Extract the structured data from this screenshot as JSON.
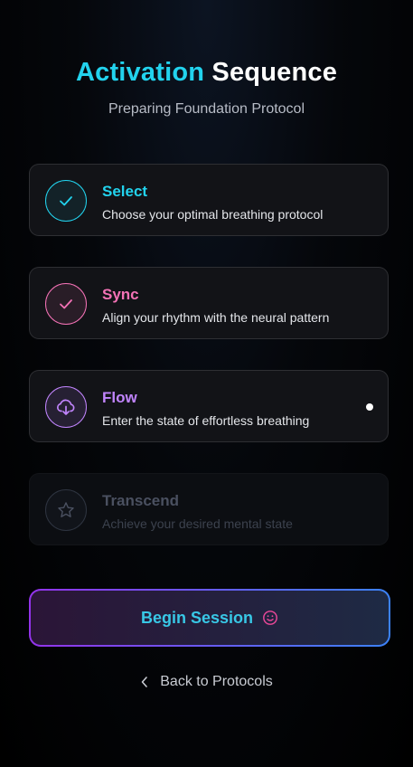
{
  "header": {
    "title_accent": "Activation",
    "title_main": "Sequence",
    "subtitle": "Preparing Foundation Protocol"
  },
  "steps": [
    {
      "name": "Select",
      "description": "Choose your optimal breathing protocol",
      "status": "completed",
      "icon": "check-icon",
      "color": "#22d3ee"
    },
    {
      "name": "Sync",
      "description": "Align your rhythm with the neural pattern",
      "status": "completed",
      "icon": "check-icon",
      "color": "#f472b6"
    },
    {
      "name": "Flow",
      "description": "Enter the state of effortless breathing",
      "status": "active",
      "icon": "cloud-download-icon",
      "color": "#c084fc"
    },
    {
      "name": "Transcend",
      "description": "Achieve your desired mental state",
      "status": "locked",
      "icon": "star-icon",
      "color": "#4a5060"
    }
  ],
  "actions": {
    "begin_label": "Begin Session",
    "begin_icon": "smile-icon",
    "back_label": "Back to Protocols",
    "back_icon": "chevron-left-icon"
  },
  "colors": {
    "accent": "#22d3ee",
    "pink": "#f472b6",
    "purple": "#c084fc",
    "inactive": "#4a5060"
  }
}
